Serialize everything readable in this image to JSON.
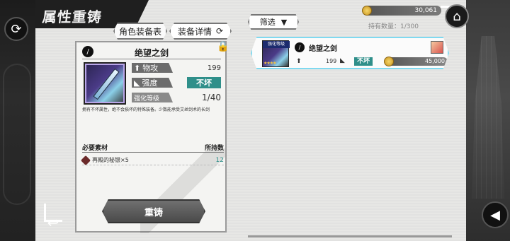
{
  "title": "属性重铸",
  "tabs": {
    "roster": "角色装备表",
    "detail": "装备详情"
  },
  "card": {
    "name": "绝望之剑",
    "stats": {
      "attack_label": "物攻",
      "attack_value": "199",
      "durability_label": "强度",
      "durability_value": "不坏",
      "level_label": "强化等级",
      "level_value": "1/40"
    },
    "description": "拥有不坏属性，绝不会损坏的特殊装备。少数能承受艾丝剑术的长剑",
    "materials": {
      "header_left": "必要素材",
      "header_right": "所持数",
      "items": [
        {
          "name": "再殿的秘银×5",
          "qty": "12"
        }
      ]
    },
    "reforge_label": "重铸"
  },
  "right": {
    "filter_label": "筛选",
    "coins": "30,061",
    "count_text": "持有数量：1/300",
    "list": [
      {
        "badge": "强化等级",
        "stars": "★★★★",
        "name": "绝望之剑",
        "attack": "199",
        "durability": "不坏",
        "price": "45,000"
      }
    ]
  },
  "icons": {
    "refresh": "refresh-icon",
    "home": "home-icon",
    "sound": "speaker-icon",
    "back": "back-arrow-icon",
    "lock": "lock-icon"
  }
}
